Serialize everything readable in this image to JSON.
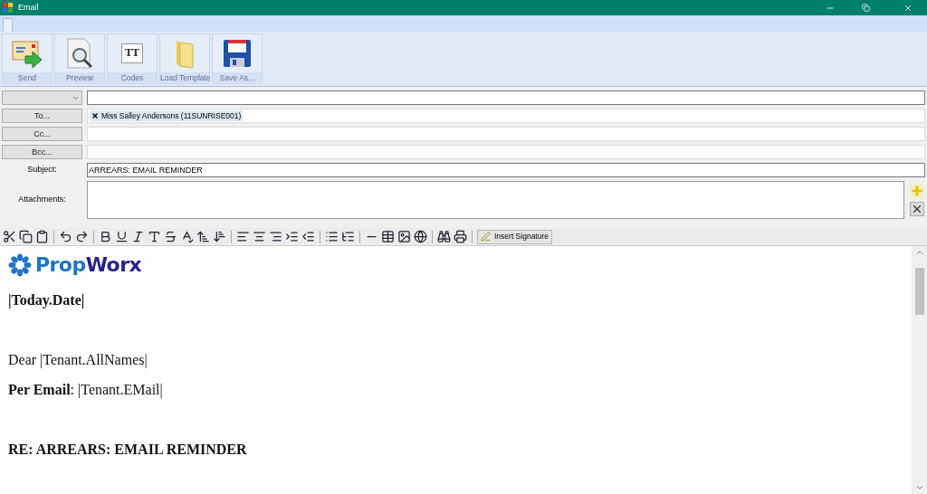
{
  "window": {
    "title": "Email"
  },
  "ribbon": {
    "buttons": [
      {
        "kind": "send",
        "label": "Send"
      },
      {
        "kind": "preview",
        "label": "Preview"
      },
      {
        "kind": "codes",
        "label": "Codes",
        "glyph": "TT"
      },
      {
        "kind": "load",
        "label": "Load Template"
      },
      {
        "kind": "save",
        "label": "Save As..."
      }
    ]
  },
  "form": {
    "to_button": "To...",
    "recipients": [
      "Miss Salley Andersons (11SUNRISE001)"
    ],
    "cc_button": "Cc...",
    "bcc_button": "Bcc...",
    "subject_label": "Subject:",
    "subject": "ARREARS: EMAIL REMINDER",
    "attachments_label": "Attachments:"
  },
  "editor_toolbar": {
    "insert_signature": "Insert Signature"
  },
  "document": {
    "logo": [
      "Prop",
      "Worx"
    ],
    "lines": [
      {
        "kind": "text",
        "text": "|Today.Date|",
        "bold": true
      },
      {
        "kind": "blank"
      },
      {
        "kind": "text",
        "text": "Dear |Tenant.AllNames|",
        "bold": false
      },
      {
        "kind": "text",
        "text": "**Per Email**: |Tenant.EMail|",
        "bold": false
      },
      {
        "kind": "blank"
      },
      {
        "kind": "text",
        "text": "RE: ARREARS: EMAIL REMINDER",
        "bold": true
      }
    ]
  }
}
